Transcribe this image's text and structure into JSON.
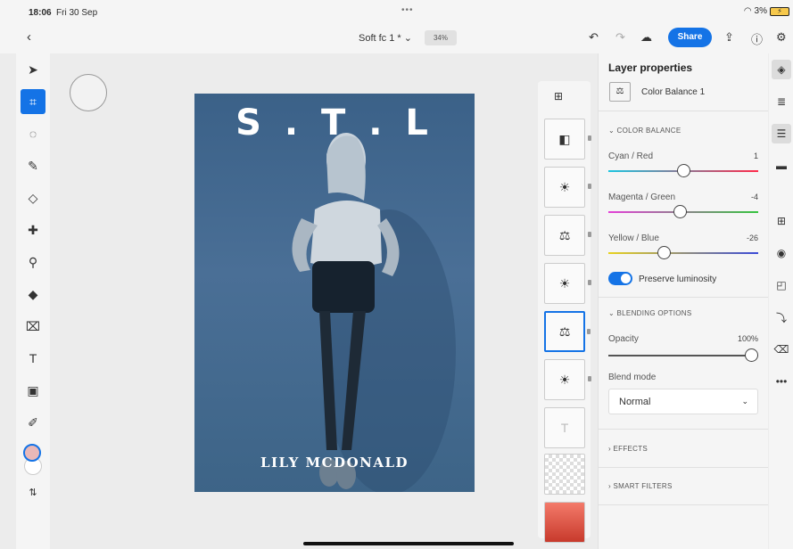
{
  "status": {
    "time": "18:06",
    "date": "Fri 30 Sep",
    "battery": "3%"
  },
  "topbar": {
    "doc_name": "Soft fc 1 * ⌄",
    "zoom": "34%",
    "share_label": "Share"
  },
  "artwork": {
    "title": "S . T . L",
    "name": "LILY MCDONALD"
  },
  "properties": {
    "heading": "Layer properties",
    "layer_name": "Color Balance 1",
    "color_balance": {
      "section_label": "COLOR BALANCE",
      "sliders": [
        {
          "label": "Cyan / Red",
          "value": 1
        },
        {
          "label": "Magenta / Green",
          "value": -4
        },
        {
          "label": "Yellow / Blue",
          "value": -26
        }
      ],
      "preserve_label": "Preserve luminosity",
      "preserve_on": true
    },
    "blending": {
      "section_label": "BLENDING OPTIONS",
      "opacity_label": "Opacity",
      "opacity_value": "100%",
      "blend_mode_label": "Blend mode",
      "blend_mode_value": "Normal"
    },
    "effects_label": "EFFECTS",
    "smart_filters_label": "SMART FILTERS"
  },
  "colors": {
    "accent": "#1473e6",
    "foreground_swatch": "#e9b8b8",
    "background_swatch": "#ffffff"
  }
}
